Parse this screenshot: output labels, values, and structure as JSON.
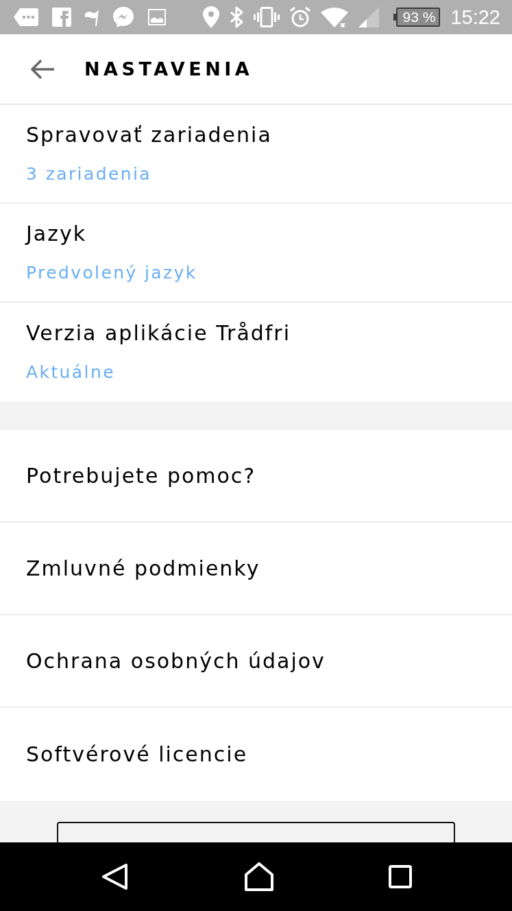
{
  "status_bar": {
    "battery": "93 %",
    "time": "15:22"
  },
  "header": {
    "title": "NASTAVENIA"
  },
  "sections": [
    {
      "items": [
        {
          "kind": "two_line",
          "title": "Spravovať zariadenia",
          "subtitle": "3 zariadenia"
        },
        {
          "kind": "two_line",
          "title": "Jazyk",
          "subtitle": "Predvolený jazyk"
        },
        {
          "kind": "two_line",
          "title": "Verzia aplikácie Trådfri",
          "subtitle": "Aktuálne"
        }
      ]
    },
    {
      "items": [
        {
          "kind": "single",
          "title": "Potrebujete pomoc?"
        },
        {
          "kind": "single",
          "title": "Zmluvné podmienky"
        },
        {
          "kind": "single",
          "title": "Ochrana osobných údajov"
        },
        {
          "kind": "single",
          "title": "Softvérové licencie"
        }
      ]
    }
  ]
}
